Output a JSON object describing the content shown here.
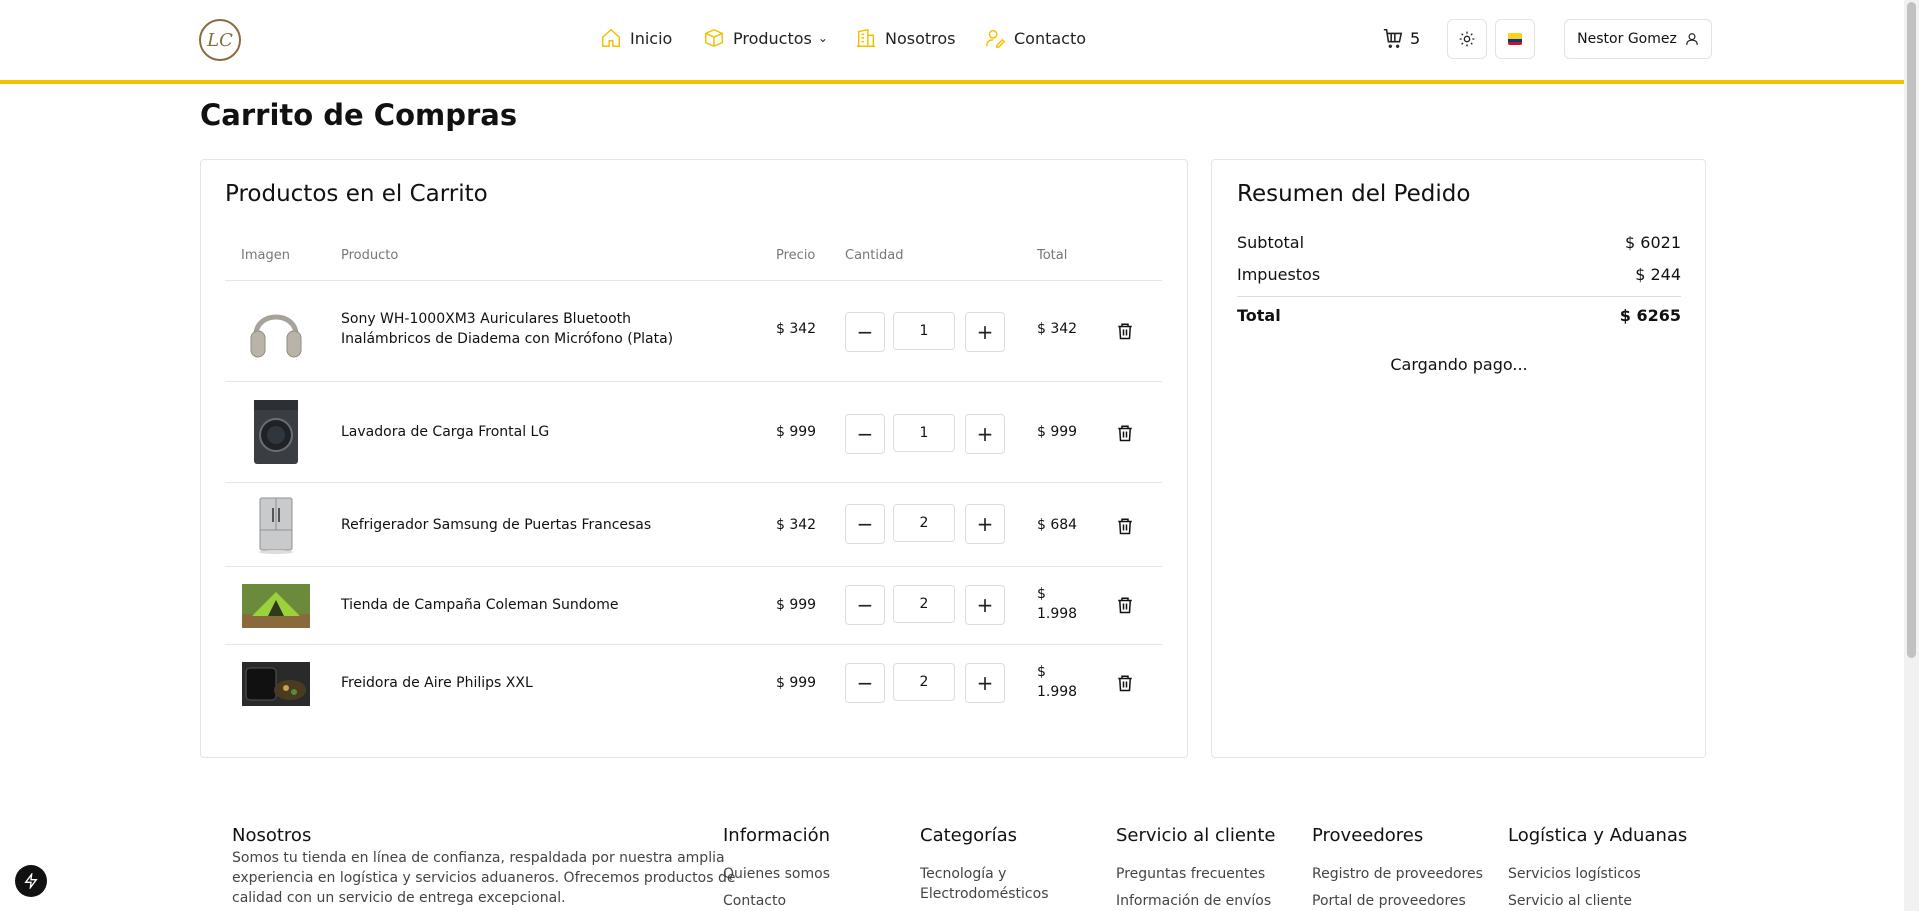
{
  "header": {
    "logo_text": "LC",
    "nav": [
      {
        "label": "Inicio",
        "icon": "home-icon"
      },
      {
        "label": "Productos",
        "icon": "box-icon",
        "chevron": "⌄"
      },
      {
        "label": "Nosotros",
        "icon": "building-icon"
      },
      {
        "label": "Contacto",
        "icon": "user-edit-icon"
      }
    ],
    "cart_count": "5",
    "user_name": "Nestor Gomez",
    "accent_color": "#f2c200"
  },
  "page_title": "Carrito de Compras",
  "cart": {
    "title": "Productos en el Carrito",
    "columns": {
      "image": "Imagen",
      "product": "Producto",
      "price": "Precio",
      "quantity": "Cantidad",
      "total": "Total"
    },
    "minus": "−",
    "plus": "+",
    "items": [
      {
        "name_l1": "Sony WH-1000XM3 Auriculares Bluetooth",
        "name_l2": "Inalámbricos de Diadema con Micrófono (Plata)",
        "price": "$ 342",
        "qty": "1",
        "total_l1": "$ 342",
        "total_l2": ""
      },
      {
        "name_l1": "Lavadora de Carga Frontal LG",
        "name_l2": "",
        "price": "$ 999",
        "qty": "1",
        "total_l1": "$ 999",
        "total_l2": ""
      },
      {
        "name_l1": "Refrigerador Samsung de Puertas Francesas",
        "name_l2": "",
        "price": "$ 342",
        "qty": "2",
        "total_l1": "$ 684",
        "total_l2": ""
      },
      {
        "name_l1": "Tienda de Campaña Coleman Sundome",
        "name_l2": "",
        "price": "$ 999",
        "qty": "2",
        "total_l1": "$",
        "total_l2": "1.998"
      },
      {
        "name_l1": "Freidora de Aire Philips XXL",
        "name_l2": "",
        "price": "$ 999",
        "qty": "2",
        "total_l1": "$",
        "total_l2": "1.998"
      }
    ]
  },
  "summary": {
    "title": "Resumen del Pedido",
    "subtotal_label": "Subtotal",
    "subtotal_value": "$ 6021",
    "tax_label": "Impuestos",
    "tax_value": "$ 244",
    "total_label": "Total",
    "total_value": "$ 6265",
    "payment_status": "Cargando pago..."
  },
  "footer": {
    "about_title": "Nosotros",
    "about_l1": "Somos tu tienda en línea de confianza, respaldada por nuestra amplia",
    "about_l2": "experiencia en logística y servicios aduaneros. Ofrecemos productos de",
    "about_l3": "calidad con un servicio de entrega excepcional.",
    "info_title": "Información",
    "info_links": [
      "Quienes somos",
      "Contacto"
    ],
    "cat_title": "Categorías",
    "cat_l1": "Tecnología y",
    "cat_l2": "Electrodomésticos",
    "service_title": "Servicio al cliente",
    "service_links": [
      "Preguntas frecuentes",
      "Información de envíos"
    ],
    "prov_title": "Proveedores",
    "prov_links": [
      "Registro de proveedores",
      "Portal de proveedores"
    ],
    "log_title": "Logística y Aduanas",
    "log_links": [
      "Servicios logísticos",
      "Servicio al cliente"
    ]
  }
}
